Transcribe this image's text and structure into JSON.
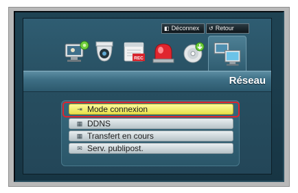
{
  "header": {
    "disconnect_label": "Déconnex",
    "back_label": "Retour"
  },
  "icons": [
    "system-setup-icon",
    "camera-icon",
    "recording-icon",
    "alarm-event-icon",
    "backup-disc-icon",
    "network-icon"
  ],
  "title": "Réseau",
  "menu": {
    "items": [
      {
        "label": "Mode connexion",
        "icon": "connection-icon",
        "selected": true
      },
      {
        "label": "DDNS",
        "icon": "ddns-icon",
        "selected": false
      },
      {
        "label": "Transfert en cours",
        "icon": "transfer-icon",
        "selected": false
      },
      {
        "label": "Serv. publipost.",
        "icon": "mail-icon",
        "selected": false
      }
    ]
  },
  "colors": {
    "highlight": "#e0232d",
    "active_item": "#f2ec6e",
    "background": "#274e60"
  }
}
